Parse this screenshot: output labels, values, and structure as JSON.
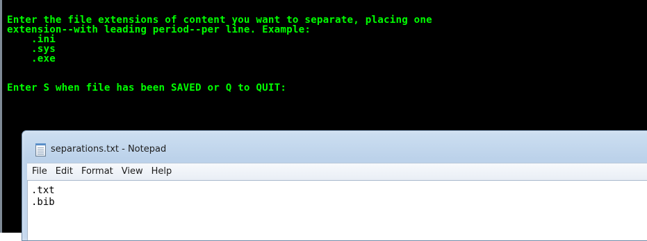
{
  "console": {
    "lines": [
      "Enter the file extensions of content you want to separate, placing one",
      "extension--with leading period--per line. Example:",
      "    .ini",
      "    .sys",
      "    .exe",
      "",
      "",
      "Enter S when file has been SAVED or Q to QUIT:"
    ]
  },
  "notepad": {
    "title": "separations.txt - Notepad",
    "menu": [
      "File",
      "Edit",
      "Format",
      "View",
      "Help"
    ],
    "content_lines": [
      ".txt",
      ".bib"
    ]
  },
  "colors": {
    "console_background": "#000000",
    "console_text": "#00ff00",
    "notepad_titlebar": "#c5d8ee",
    "notepad_editor": "#ffffff"
  },
  "icons": {
    "notepad_app": "notepad-icon"
  }
}
